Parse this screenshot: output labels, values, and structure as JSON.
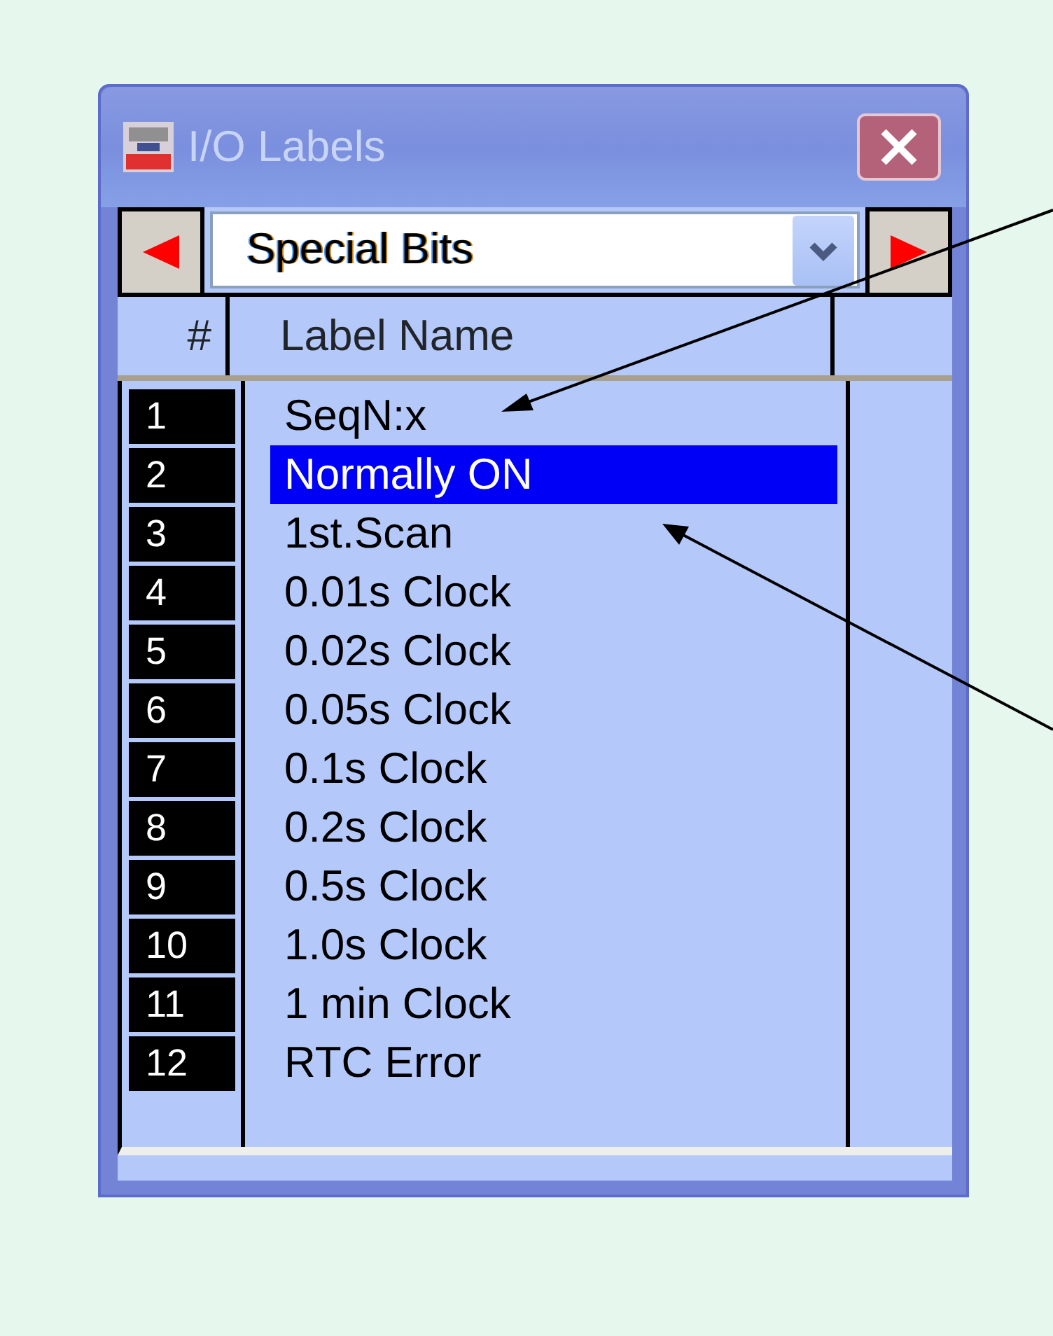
{
  "window": {
    "title": "I/O Labels"
  },
  "category": {
    "value": "Special Bits"
  },
  "columns": [
    "#",
    "Label Name"
  ],
  "rows": [
    {
      "number": "1",
      "label": "SeqN:x",
      "selected": false
    },
    {
      "number": "2",
      "label": "Normally ON",
      "selected": true
    },
    {
      "number": "3",
      "label": "1st.Scan",
      "selected": false
    },
    {
      "number": "4",
      "label": "0.01s Clock",
      "selected": false
    },
    {
      "number": "5",
      "label": "0.02s Clock",
      "selected": false
    },
    {
      "number": "6",
      "label": "0.05s Clock",
      "selected": false
    },
    {
      "number": "7",
      "label": "0.1s Clock",
      "selected": false
    },
    {
      "number": "8",
      "label": "0.2s Clock",
      "selected": false
    },
    {
      "number": "9",
      "label": "0.5s Clock",
      "selected": false
    },
    {
      "number": "10",
      "label": "1.0s Clock",
      "selected": false
    },
    {
      "number": "11",
      "label": "1 min Clock",
      "selected": false
    },
    {
      "number": "12",
      "label": "RTC Error",
      "selected": false
    }
  ]
}
